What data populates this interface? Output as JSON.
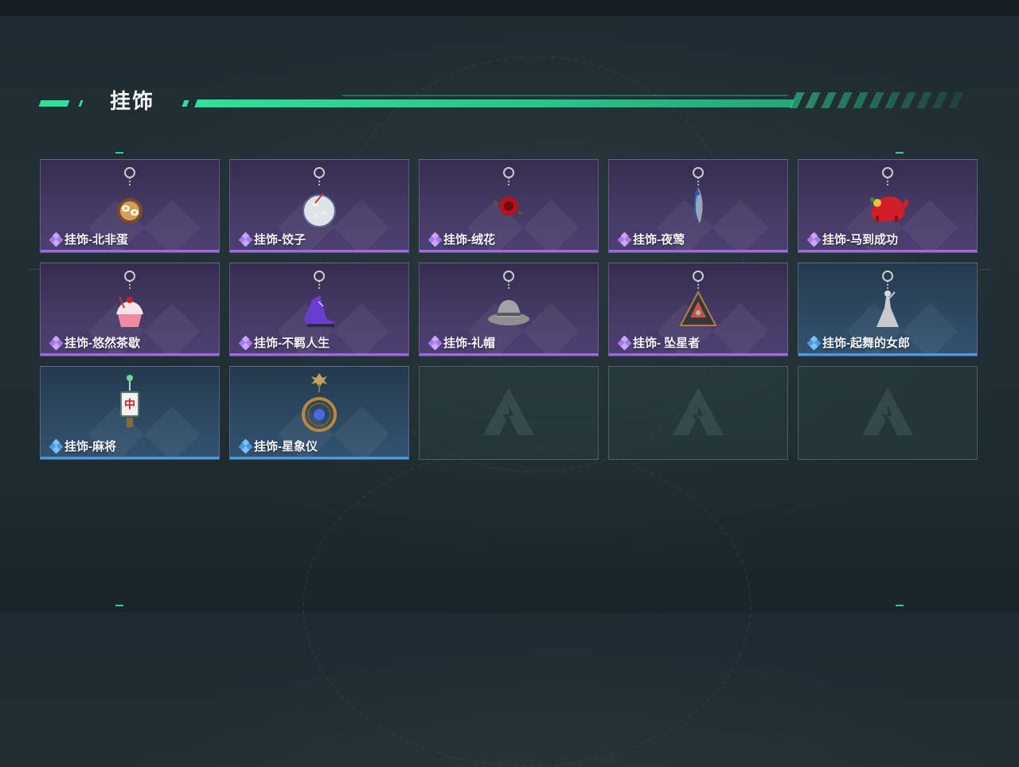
{
  "section_title": "挂饰",
  "colors": {
    "accent": "#2fe09a",
    "rarity_purple": "#9a6ce0",
    "rarity_blue": "#4a9ae0"
  },
  "items": [
    {
      "label": "挂饰-北非蛋",
      "rarity": "purple",
      "icon": "egg-pan-charm-icon"
    },
    {
      "label": "挂饰-饺子",
      "rarity": "purple",
      "icon": "dumpling-plate-charm-icon"
    },
    {
      "label": "挂饰-绒花",
      "rarity": "purple",
      "icon": "red-velvet-flower-charm-icon"
    },
    {
      "label": "挂饰-夜莺",
      "rarity": "purple",
      "icon": "nightingale-feather-charm-icon"
    },
    {
      "label": "挂饰-马到成功",
      "rarity": "purple",
      "icon": "red-horse-charm-icon"
    },
    {
      "label": "挂饰-悠然茶歇",
      "rarity": "purple",
      "icon": "cupcake-charm-icon"
    },
    {
      "label": "挂饰-不羁人生",
      "rarity": "purple",
      "icon": "purple-sneaker-charm-icon"
    },
    {
      "label": "挂饰-礼帽",
      "rarity": "purple",
      "icon": "fedora-hat-charm-icon"
    },
    {
      "label": "挂饰- 坠星者",
      "rarity": "purple",
      "icon": "triangle-emblem-charm-icon"
    },
    {
      "label": "挂饰-起舞的女郎",
      "rarity": "blue",
      "icon": "dancing-lady-charm-icon"
    },
    {
      "label": "挂饰-麻将",
      "rarity": "blue",
      "icon": "mahjong-tile-charm-icon"
    },
    {
      "label": "挂饰-星象仪",
      "rarity": "blue",
      "icon": "astrolabe-charm-icon"
    },
    {
      "label": "",
      "rarity": "empty",
      "icon": "empty-slot-logo-icon"
    },
    {
      "label": "",
      "rarity": "empty",
      "icon": "empty-slot-logo-icon"
    },
    {
      "label": "",
      "rarity": "empty",
      "icon": "empty-slot-logo-icon"
    }
  ]
}
